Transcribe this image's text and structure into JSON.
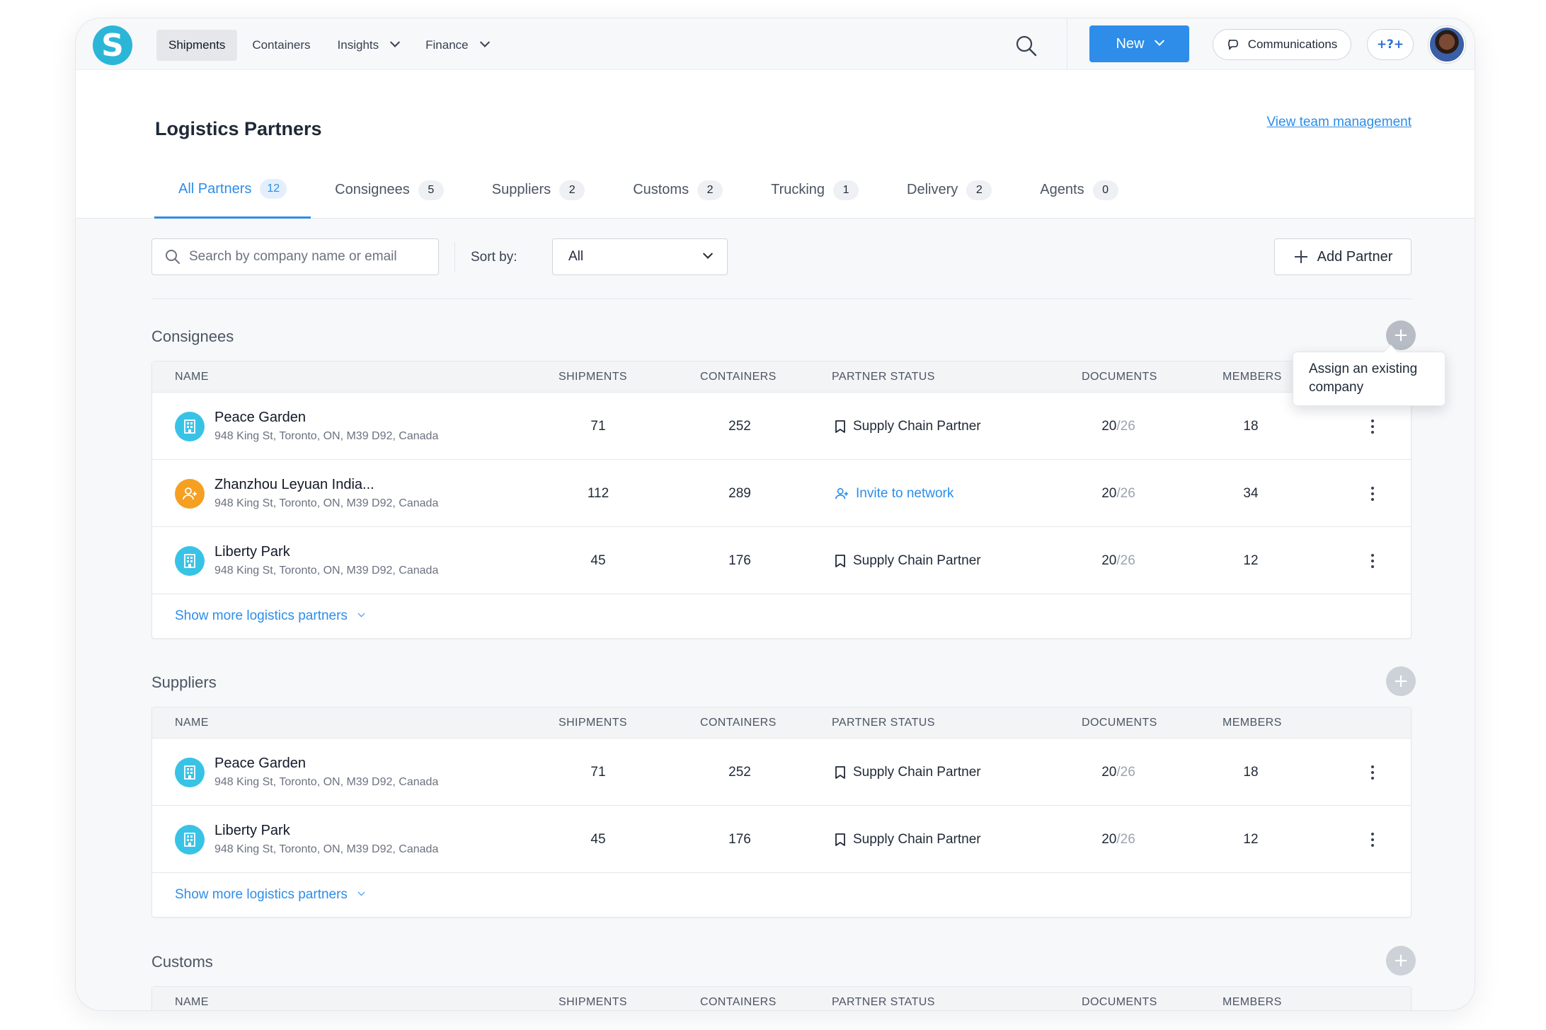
{
  "nav": {
    "logo_letter": "S",
    "links": [
      {
        "label": "Shipments",
        "active": true,
        "dropdown": false
      },
      {
        "label": "Containers",
        "active": false,
        "dropdown": false
      },
      {
        "label": "Insights",
        "active": false,
        "dropdown": true
      },
      {
        "label": "Finance",
        "active": false,
        "dropdown": true
      }
    ],
    "new_label": "New",
    "communications_label": "Communications",
    "help_label": "+?+"
  },
  "page": {
    "title": "Logistics Partners",
    "team_link": "View team management"
  },
  "tabs": [
    {
      "label": "All Partners",
      "count": "12",
      "active": true
    },
    {
      "label": "Consignees",
      "count": "5",
      "active": false
    },
    {
      "label": "Suppliers",
      "count": "2",
      "active": false
    },
    {
      "label": "Customs",
      "count": "2",
      "active": false
    },
    {
      "label": "Trucking",
      "count": "1",
      "active": false
    },
    {
      "label": "Delivery",
      "count": "2",
      "active": false
    },
    {
      "label": "Agents",
      "count": "0",
      "active": false
    }
  ],
  "toolbar": {
    "search_placeholder": "Search by company name or email",
    "sort_label": "Sort by:",
    "sort_value": "All",
    "add_partner_label": "Add Partner"
  },
  "columns": [
    "NAME",
    "SHIPMENTS",
    "CONTAINERS",
    "PARTNER STATUS",
    "DOCUMENTS",
    "MEMBERS"
  ],
  "tooltip": "Assign an existing company",
  "sections": [
    {
      "title": "Consignees",
      "show_more": "Show more logistics partners",
      "rows": [
        {
          "name": "Peace Garden",
          "address": "948 King St, Toronto, ON, M39 D92, Canada",
          "shipments": "71",
          "containers": "252",
          "status": "Supply Chain Partner",
          "status_type": "partner",
          "docs_done": "20",
          "docs_total": "/26",
          "members": "18",
          "icon": "building-icon"
        },
        {
          "name": "Zhanzhou Leyuan India...",
          "address": "948 King St, Toronto, ON, M39 D92, Canada",
          "shipments": "112",
          "containers": "289",
          "status": "Invite to network",
          "status_type": "invite",
          "docs_done": "20",
          "docs_total": "/26",
          "members": "34",
          "icon": "user-plus-icon"
        },
        {
          "name": "Liberty Park",
          "address": "948 King St, Toronto, ON, M39 D92, Canada",
          "shipments": "45",
          "containers": "176",
          "status": "Supply Chain Partner",
          "status_type": "partner",
          "docs_done": "20",
          "docs_total": "/26",
          "members": "12",
          "icon": "building-icon"
        }
      ]
    },
    {
      "title": "Suppliers",
      "show_more": "Show more logistics partners",
      "rows": [
        {
          "name": "Peace Garden",
          "address": "948 King St, Toronto, ON, M39 D92, Canada",
          "shipments": "71",
          "containers": "252",
          "status": "Supply Chain Partner",
          "status_type": "partner",
          "docs_done": "20",
          "docs_total": "/26",
          "members": "18",
          "icon": "building-icon"
        },
        {
          "name": "Liberty Park",
          "address": "948 King St, Toronto, ON, M39 D92, Canada",
          "shipments": "45",
          "containers": "176",
          "status": "Supply Chain Partner",
          "status_type": "partner",
          "docs_done": "20",
          "docs_total": "/26",
          "members": "12",
          "icon": "building-icon"
        }
      ]
    },
    {
      "title": "Customs",
      "show_more": "",
      "rows": []
    }
  ],
  "colors": {
    "accent": "#2d8de8",
    "teal": "#38c3e6",
    "orange": "#f5a023"
  }
}
